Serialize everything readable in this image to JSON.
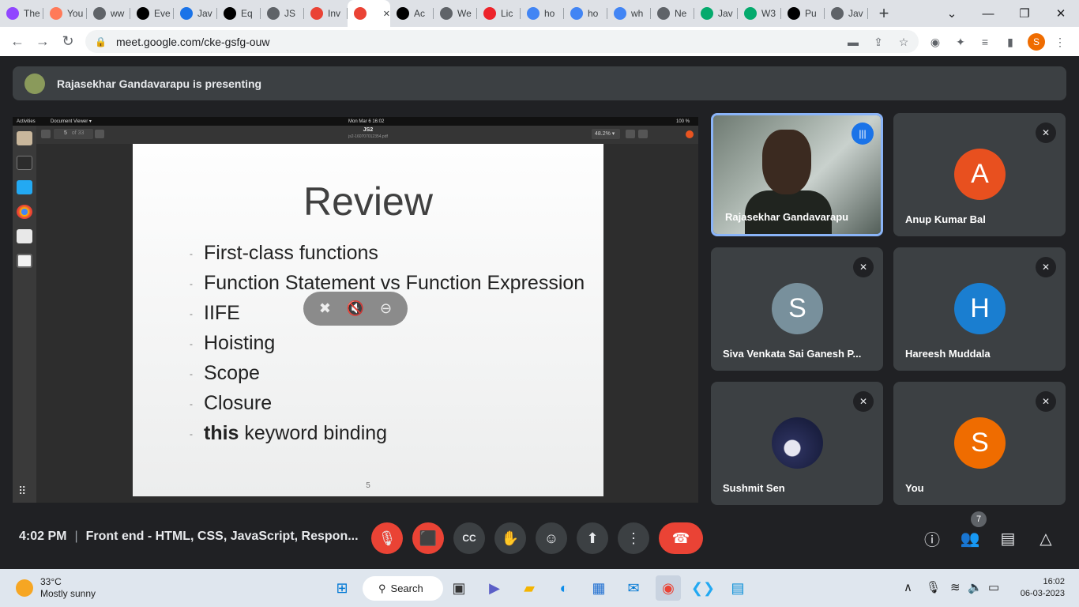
{
  "browser": {
    "tabs": [
      {
        "label": "The",
        "icon": "twitch-icon",
        "color": "#9146ff"
      },
      {
        "label": "You",
        "icon": "hubspot-icon",
        "color": "#ff7a59"
      },
      {
        "label": "ww",
        "icon": "globe-icon",
        "color": "#5f6368"
      },
      {
        "label": "Eve",
        "icon": "medium-icon",
        "color": "#000000"
      },
      {
        "label": "Jav",
        "icon": "loading-icon",
        "color": "#1a73e8"
      },
      {
        "label": "Eq",
        "icon": "medium-icon",
        "color": "#000000"
      },
      {
        "label": "JS",
        "icon": "globe-icon",
        "color": "#5f6368"
      },
      {
        "label": "Inv",
        "icon": "gmail-icon",
        "color": "#ea4335"
      },
      {
        "label": "",
        "icon": "recording-icon",
        "color": "#ea4335",
        "active": true
      },
      {
        "label": "Ac",
        "icon": "github-icon",
        "color": "#000000"
      },
      {
        "label": "We",
        "icon": "globe-icon",
        "color": "#5f6368"
      },
      {
        "label": "Lic",
        "icon": "hdfc-icon",
        "color": "#ed232a"
      },
      {
        "label": "ho",
        "icon": "google-icon",
        "color": "#4285f4"
      },
      {
        "label": "ho",
        "icon": "google-icon",
        "color": "#4285f4"
      },
      {
        "label": "wh",
        "icon": "google-icon",
        "color": "#4285f4"
      },
      {
        "label": "Ne",
        "icon": "chrome-icon",
        "color": "#5f6368"
      },
      {
        "label": "Jav",
        "icon": "w3schools-icon",
        "color": "#04aa6d"
      },
      {
        "label": "W3",
        "icon": "w3schools-icon",
        "color": "#04aa6d"
      },
      {
        "label": "Pu",
        "icon": "github-icon",
        "color": "#000000"
      },
      {
        "label": "Jav",
        "icon": "globe-icon",
        "color": "#5f6368"
      }
    ],
    "url": "meet.google.com/cke-gsfg-ouw",
    "profile_initial": "S"
  },
  "meet": {
    "presenting_banner": "Rajasekhar Gandavarapu is presenting",
    "shared_screen": {
      "ubuntu_topbar": {
        "activities": "Activities",
        "app": "Document Viewer ▾",
        "clock": "Mon Mar 6  16:02",
        "battery": "100 %"
      },
      "viewer": {
        "page": "5",
        "of": "of 33",
        "doc_title": "JS2",
        "doc_file": "js2-160707012354.pdf",
        "zoom": "48.2% ▾"
      },
      "slide": {
        "title": "Review",
        "bullets": [
          "First-class functions",
          "Function Statement vs Function Expression",
          "IIFE",
          "Hoisting",
          "Scope",
          "Closure"
        ],
        "last_bullet_bold": "this",
        "last_bullet_rest": " keyword binding",
        "page_number": "5"
      }
    },
    "participants": [
      {
        "name": "Rajasekhar Gandavarapu",
        "video": true,
        "speaking": true
      },
      {
        "name": "Anup Kumar Bal",
        "initial": "A",
        "color": "#e8501f",
        "muted": true
      },
      {
        "name": "Siva Venkata Sai Ganesh P...",
        "initial": "S",
        "color": "#78909c",
        "muted": true
      },
      {
        "name": "Hareesh Muddala",
        "initial": "H",
        "color": "#1a7ed0",
        "muted": true
      },
      {
        "name": "Sushmit Sen",
        "avatar": "astronaut-avatar",
        "muted": true
      },
      {
        "name": "You",
        "initial": "S",
        "color": "#ef6c00",
        "muted": true
      }
    ],
    "controls": {
      "time": "4:02 PM",
      "meeting_title": "Front end - HTML, CSS, JavaScript, Respon...",
      "participant_count": "7"
    }
  },
  "taskbar": {
    "weather_temp": "33°C",
    "weather_desc": "Mostly sunny",
    "search_label": "Search",
    "time": "16:02",
    "date": "06-03-2023"
  }
}
